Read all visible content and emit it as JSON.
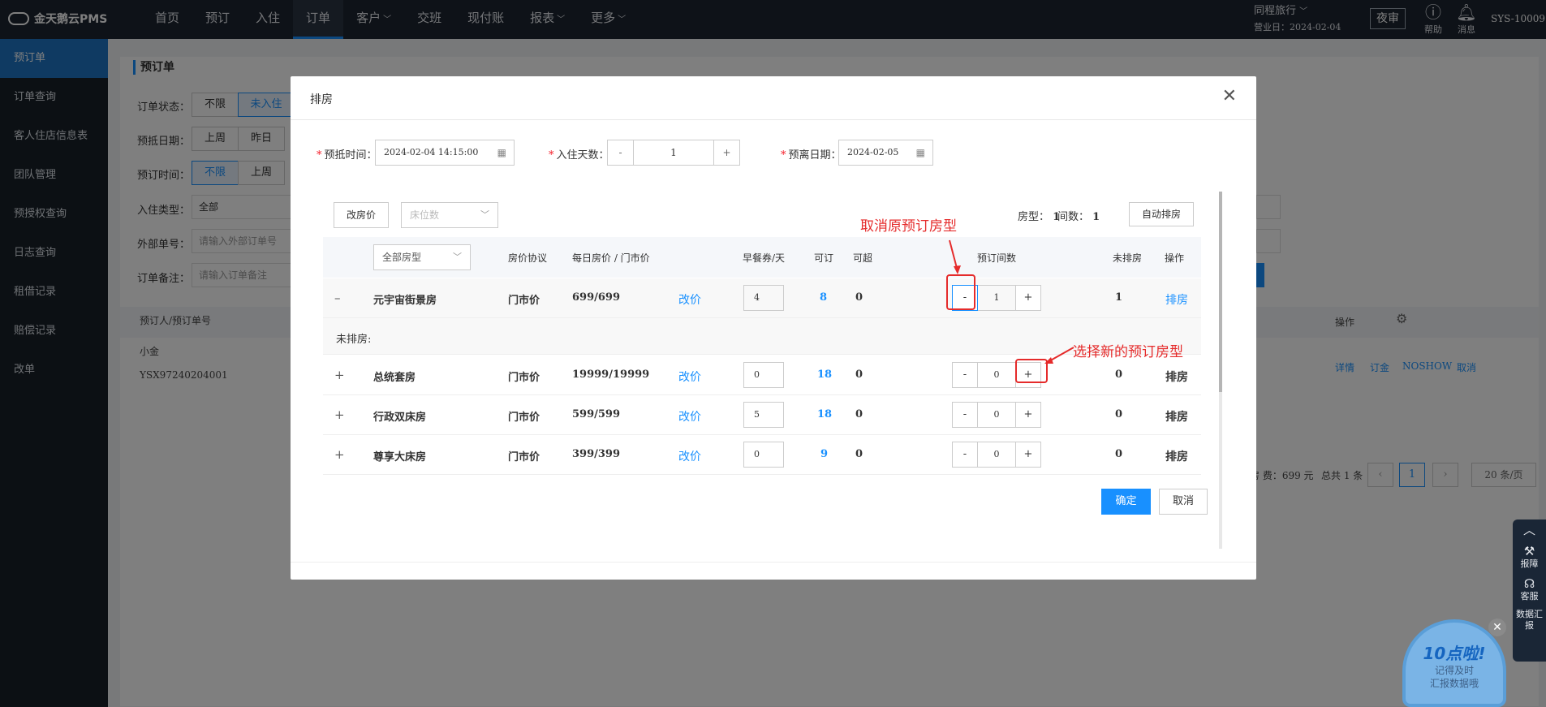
{
  "app": {
    "logo": "金天鹅云PMS"
  },
  "nav": [
    "首页",
    "预订",
    "入住",
    "订单",
    "客户",
    "交班",
    "现付账",
    "报表",
    "更多"
  ],
  "nav_dropdown": [
    "客户",
    "报表",
    "更多"
  ],
  "top_right": {
    "hotel_name": "同程旅行",
    "business_day": "营业日：2024-02-04",
    "night_audit": "夜审",
    "help": "帮助",
    "messages": "消息",
    "user": "SYS-10009"
  },
  "sidebar": [
    "预订单",
    "订单查询",
    "客人住店信息表",
    "团队管理",
    "预授权查询",
    "日志查询",
    "租借记录",
    "赔偿记录",
    "改单"
  ],
  "background": {
    "section_title": "预订单",
    "order_status_label": "订单状态：",
    "order_status_opts": [
      "不限",
      "未入住"
    ],
    "arrive_date_label": "预抵日期：",
    "arrive_opts": [
      "上周",
      "昨日"
    ],
    "book_time_label": "预订时间：",
    "book_opts": [
      "不限",
      "上周"
    ],
    "checkin_type_label": "入住类型：",
    "checkin_type_value": "全部",
    "ext_no_label": "外部单号：",
    "ext_no_placeholder": "请输入外部订单号",
    "remark_label": "订单备注：",
    "remark_placeholder": "请输入订单备注",
    "col_booker": "预订人/预订单号",
    "col_ops": "操作",
    "booker": "小金",
    "order_no": "YSX97240204001",
    "row_ops": [
      "详情",
      "订金",
      "NOSHOW",
      "取消"
    ],
    "fee": "房 费：699 元",
    "total": "总共 1 条",
    "page": "1",
    "page_size": "20 条/页"
  },
  "float_tools": [
    "报障",
    "客服",
    "数据汇报"
  ],
  "bubble": {
    "title": "10点啦!",
    "line1": "记得及时",
    "line2": "汇报数据哦"
  },
  "modal": {
    "title": "排房",
    "arrive_label": "预抵时间：",
    "arrive_value": "2024-02-04 14:15:00",
    "nights_label": "入住天数：",
    "nights_value": "1",
    "depart_label": "预离日期：",
    "depart_value": "2024-02-05",
    "change_price_btn": "改房价",
    "bed_placeholder": "床位数",
    "room_type_label": "房型：",
    "room_type_count": "1",
    "room_count_label": "间数：",
    "room_count": "1",
    "auto_assign": "自动排房",
    "headers": {
      "all_types": "全部房型",
      "protocol": "房价协议",
      "price": "每日房价 / 门市价",
      "breakfast": "早餐券/天",
      "bookable": "可订",
      "overbook": "可超",
      "book_count": "预订间数",
      "unassigned": "未排房",
      "ops": "操作"
    },
    "unassigned_section": "未排房:",
    "rows": [
      {
        "name": "元宇宙街景房",
        "protocol": "门市价",
        "price": "699/699",
        "change": "改价",
        "breakfast": "4",
        "bookable": "8",
        "overbook": "0",
        "count": "1",
        "unassigned": "1",
        "op": "排房",
        "expand": "–"
      },
      {
        "name": "总统套房",
        "protocol": "门市价",
        "price": "19999/19999",
        "change": "改价",
        "breakfast": "0",
        "bookable": "18",
        "overbook": "0",
        "count": "0",
        "unassigned": "0",
        "op": "排房",
        "expand": "+"
      },
      {
        "name": "行政双床房",
        "protocol": "门市价",
        "price": "599/599",
        "change": "改价",
        "breakfast": "5",
        "bookable": "18",
        "overbook": "0",
        "count": "0",
        "unassigned": "0",
        "op": "排房",
        "expand": "+"
      },
      {
        "name": "尊享大床房",
        "protocol": "门市价",
        "price": "399/399",
        "change": "改价",
        "breakfast": "0",
        "bookable": "9",
        "overbook": "0",
        "count": "0",
        "unassigned": "0",
        "op": "排房",
        "expand": "+"
      }
    ],
    "confirm": "确定",
    "cancel": "取消"
  },
  "annotations": {
    "cancel_original": "取消原预订房型",
    "select_new": "选择新的预订房型",
    "color": "#e52b2b"
  }
}
